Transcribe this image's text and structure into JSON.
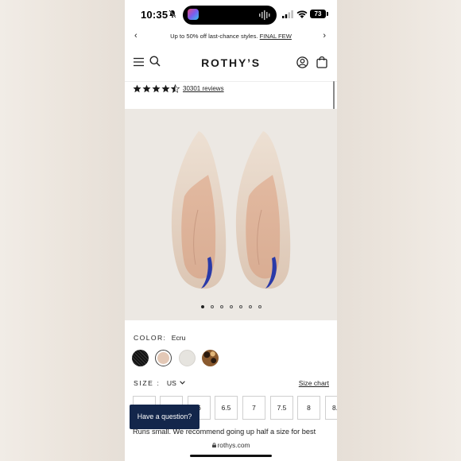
{
  "status_bar": {
    "time": "10:35",
    "battery": "73"
  },
  "promo": {
    "text": "Up to 50% off last-chance styles.",
    "link": "FINAL FEW"
  },
  "header": {
    "logo": "ROTHY’S"
  },
  "rating": {
    "stars": 4.5,
    "reviews": "30301 reviews"
  },
  "carousel": {
    "total": 7,
    "active": 1
  },
  "color": {
    "label": "COLOR:",
    "value": "Ecru",
    "swatches": [
      {
        "name": "black",
        "color": "#1d1d1d"
      },
      {
        "name": "ecru",
        "color": "#e3c8b6"
      },
      {
        "name": "light-grey",
        "color": "#e6e4df"
      },
      {
        "name": "leopard",
        "color": "#8a5a2e"
      }
    ]
  },
  "size": {
    "label": "SIZE :",
    "unit": "US",
    "chart_link": "Size chart",
    "options": [
      "",
      "",
      "6",
      "6.5",
      "7",
      "7.5",
      "8",
      "8."
    ]
  },
  "fit_note": "Runs small. We recommend going up half a size for best",
  "chat": {
    "label": "Have a question?"
  },
  "url": "rothys.com"
}
